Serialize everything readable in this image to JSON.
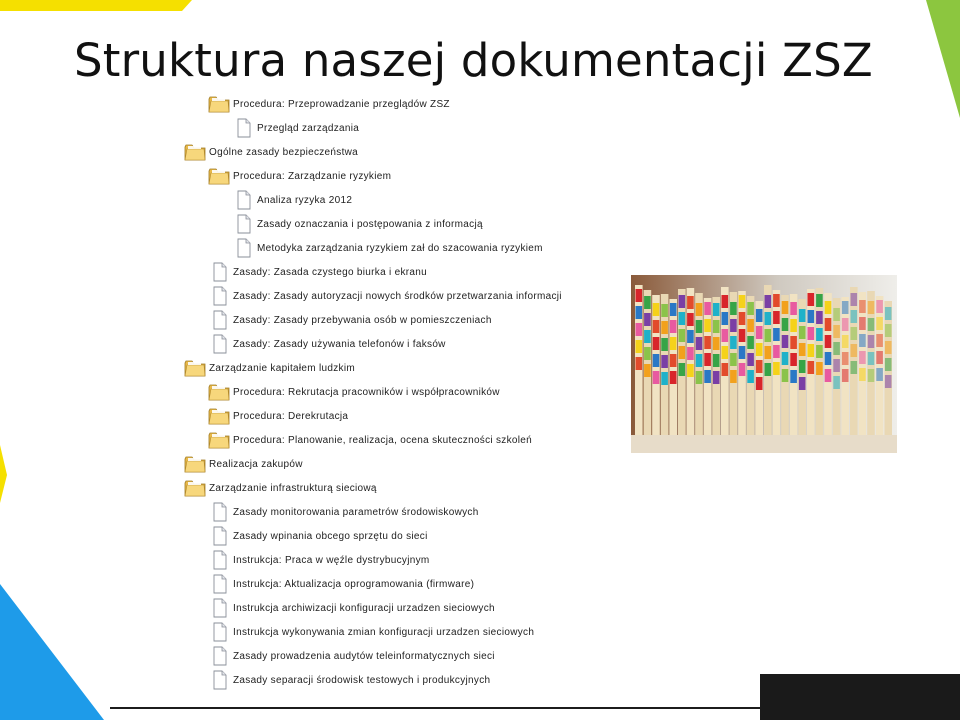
{
  "slide": {
    "title": "Struktura naszej dokumentacji ZSZ"
  },
  "tree": [
    {
      "level": 1,
      "type": "folder",
      "label": "Procedura: Przeprowadzanie przeglądów ZSZ"
    },
    {
      "level": 2,
      "type": "doc",
      "label": "Przegląd zarządzania"
    },
    {
      "level": 0,
      "type": "folder",
      "label": "Ogólne zasady bezpieczeństwa"
    },
    {
      "level": 1,
      "type": "folder",
      "label": "Procedura: Zarządzanie ryzykiem"
    },
    {
      "level": 2,
      "type": "doc",
      "label": "Analiza ryzyka 2012"
    },
    {
      "level": 2,
      "type": "doc",
      "label": "Zasady oznaczania i postępowania z informacją"
    },
    {
      "level": 2,
      "type": "doc",
      "label": "Metodyka zarządzania ryzykiem zał do szacowania ryzykiem"
    },
    {
      "level": 1,
      "type": "doc",
      "label": "Zasady: Zasada czystego biurka i ekranu"
    },
    {
      "level": 1,
      "type": "doc",
      "label": "Zasady: Zasady autoryzacji nowych środków przetwarzania informacji"
    },
    {
      "level": 1,
      "type": "doc",
      "label": "Zasady: Zasady przebywania osób w pomieszczeniach"
    },
    {
      "level": 1,
      "type": "doc",
      "label": "Zasady: Zasady używania telefonów i faksów"
    },
    {
      "level": 0,
      "type": "folder",
      "label": "Zarządzanie kapitałem ludzkim"
    },
    {
      "level": 1,
      "type": "folder",
      "label": "Procedura: Rekrutacja pracowników i współpracowników"
    },
    {
      "level": 1,
      "type": "folder",
      "label": "Procedura: Derekrutacja"
    },
    {
      "level": 1,
      "type": "folder",
      "label": "Procedura: Planowanie, realizacja, ocena skuteczności szkoleń"
    },
    {
      "level": 0,
      "type": "folder",
      "label": "Realizacja zakupów"
    },
    {
      "level": 0,
      "type": "folder",
      "label": "Zarządzanie infrastrukturą sieciową"
    },
    {
      "level": 1,
      "type": "doc",
      "label": "Zasady monitorowania parametrów środowiskowych"
    },
    {
      "level": 1,
      "type": "doc",
      "label": "Zasady wpinania obcego sprzętu do sieci"
    },
    {
      "level": 1,
      "type": "doc",
      "label": "Instrukcja: Praca w węźle dystrybucyjnym"
    },
    {
      "level": 1,
      "type": "doc",
      "label": "Instrukcja: Aktualizacja oprogramowania (firmware)"
    },
    {
      "level": 1,
      "type": "doc",
      "label": "Instrukcja archiwizacji konfiguracji urzadzen sieciowych"
    },
    {
      "level": 1,
      "type": "doc",
      "label": "Instrukcja wykonywania zmian konfiguracji urzadzen sieciowych"
    },
    {
      "level": 1,
      "type": "doc",
      "label": "Zasady prowadzenia audytów teleinformatycznych sieci"
    },
    {
      "level": 1,
      "type": "doc",
      "label": "Zasady separacji środowisk testowych i produkcyjnych"
    }
  ],
  "icons": {
    "folder": "folder-icon",
    "doc": "document-icon"
  },
  "colors": {
    "accent_yellow": "#F5E000",
    "accent_green": "#8CC63F",
    "accent_blue": "#1E9BE9",
    "dark": "#1A1A1A"
  }
}
